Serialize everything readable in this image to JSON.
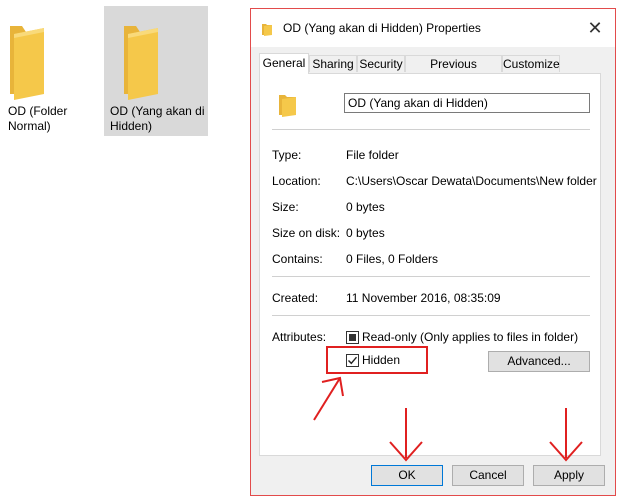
{
  "desktop": {
    "folders": [
      {
        "label": "OD (Folder Normal)",
        "selected": false
      },
      {
        "label": "OD (Yang akan di Hidden)",
        "selected": true
      }
    ]
  },
  "dialog": {
    "title": "OD (Yang akan di Hidden) Properties",
    "close_glyph": "✕",
    "tabs": [
      "General",
      "Sharing",
      "Security",
      "Previous Versions",
      "Customize"
    ],
    "active_tab": "General",
    "name_value": "OD (Yang akan di Hidden)",
    "props": [
      {
        "label": "Type:",
        "value": "File folder"
      },
      {
        "label": "Location:",
        "value": "C:\\Users\\Oscar Dewata\\Documents\\New folder"
      },
      {
        "label": "Size:",
        "value": "0 bytes"
      },
      {
        "label": "Size on disk:",
        "value": "0 bytes"
      },
      {
        "label": "Contains:",
        "value": "0 Files, 0 Folders"
      }
    ],
    "created": {
      "label": "Created:",
      "value": "11 November 2016, 08:35:09"
    },
    "attributes": {
      "label": "Attributes:",
      "readonly": {
        "label": "Read-only (Only applies to files in folder)",
        "state": "indeterminate"
      },
      "hidden": {
        "label": "Hidden",
        "state": "checked"
      },
      "advanced_label": "Advanced..."
    },
    "buttons": {
      "ok": "OK",
      "cancel": "Cancel",
      "apply": "Apply"
    }
  },
  "colors": {
    "annotation": "#e02020",
    "folder": "#f5c84a",
    "accent": "#0078d7"
  }
}
